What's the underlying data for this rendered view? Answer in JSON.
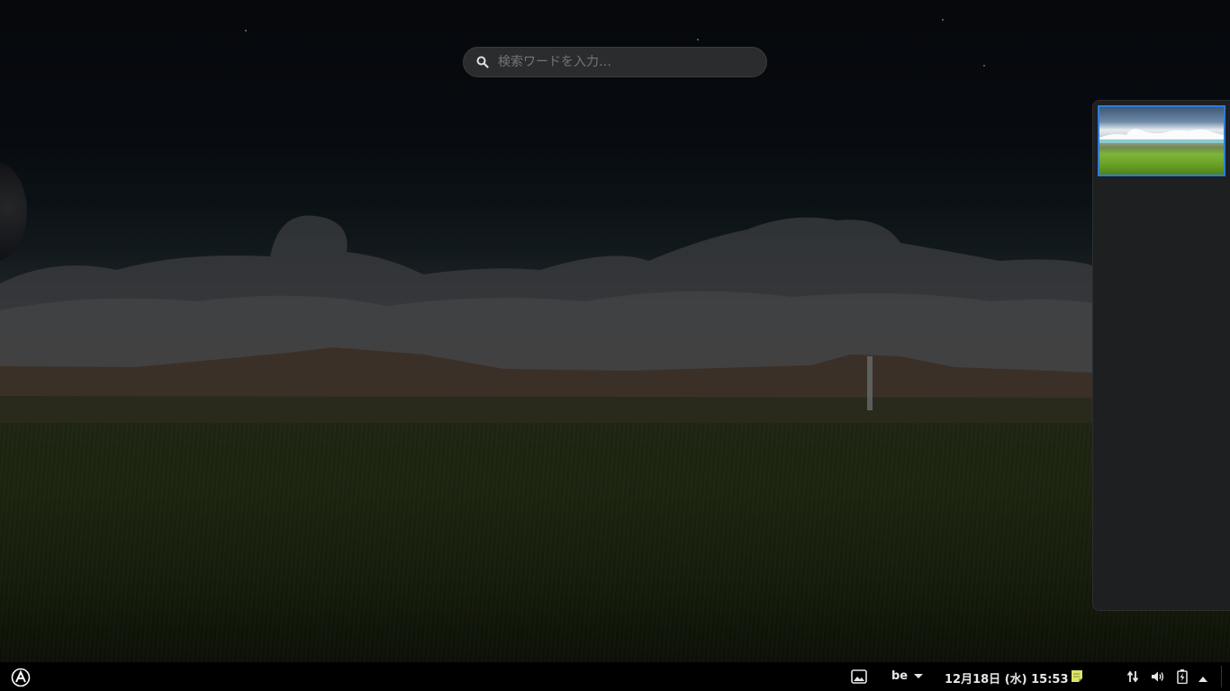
{
  "search": {
    "placeholder": "検索ワードを入力…"
  },
  "workspaces": {
    "items": [
      {
        "label": "workspace-1",
        "active": true
      }
    ],
    "accent_color": "#2e7cd9"
  },
  "panel": {
    "keyboard_layout": "be",
    "clock": "12月18日 (水) 15:53"
  },
  "icons": {
    "activities": "activities-icon",
    "search": "search-icon",
    "screenshot": "screenshot-icon",
    "dropdown": "chevron-down-icon",
    "note": "note-icon",
    "network": "network-icon",
    "volume": "volume-icon",
    "battery": "battery-icon",
    "menu": "menu-triangle-icon"
  }
}
